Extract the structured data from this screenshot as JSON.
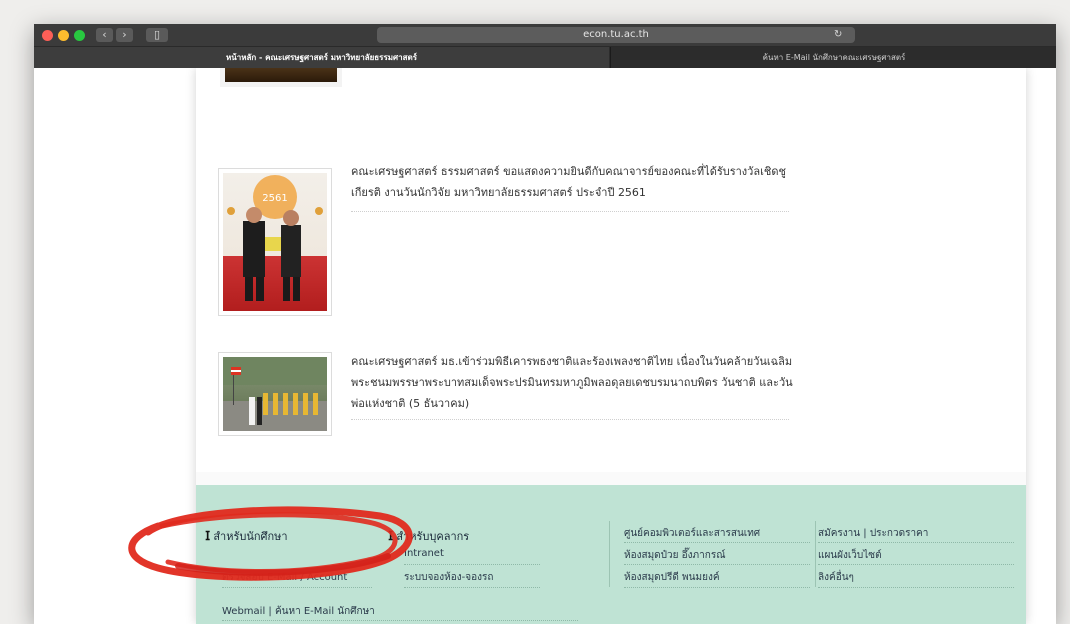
{
  "browser": {
    "url": "econ.tu.ac.th",
    "tabs": [
      {
        "label": "หน้าหลัก - คณะเศรษฐศาสตร์ มหาวิทยาลัยธรรมศาสตร์",
        "active": true
      },
      {
        "label": "ค้นหา E-Mail นักศึกษาคณะเศรษฐศาสตร์",
        "active": false
      }
    ]
  },
  "news": [
    {
      "line1": "คณะเศรษฐศาสตร์ ธรรมศาสตร์ ขอแสดงความยินดีกับคณาจารย์ของคณะที่ได้รับรางวัลเชิดชู",
      "line2": "เกียรติ งานวันนักวิจัย มหาวิทยาลัยธรรมศาสตร์ ประจำปี 2561"
    },
    {
      "line1": "คณะเศรษฐศาสตร์ มธ.เข้าร่วมพิธีเคารพธงชาติและร้องเพลงชาติไทย เนื่องในวันคล้ายวันเฉลิม",
      "line2": "พระชนมพรรษาพระบาทสมเด็จพระปรมินทรมหาภูมิพลอดุลยเดชบรมนาถบพิตร วันชาติ และวัน",
      "line3": "พ่อแห่งชาติ (5 ธันวาคม)"
    }
  ],
  "footer": {
    "students": {
      "heading": "สำหรับนักศึกษา",
      "links": [
        "ตรวจสอบ E-Mail / Account",
        "Webmail | ค้นหา E-Mail นักศึกษา"
      ]
    },
    "staff": {
      "heading": "สำหรับบุคลากร",
      "links": [
        "Intranet",
        "ระบบจองห้อง-จองรถ"
      ]
    },
    "col3": {
      "links": [
        "ศูนย์คอมพิวเตอร์และสารสนเทศ",
        "ห้องสมุดป๋วย อึ๊งภากรณ์",
        "ห้องสมุดปรีดี พนมยงค์"
      ]
    },
    "col4": {
      "links": [
        "สมัครงาน | ประกวดราคา",
        "แผนผังเว็บไซต์",
        "ลิงค์อื่นๆ"
      ]
    }
  },
  "colors": {
    "footer_bg": "#bfe3d4",
    "highlight_scribble": "#e02a1e"
  }
}
